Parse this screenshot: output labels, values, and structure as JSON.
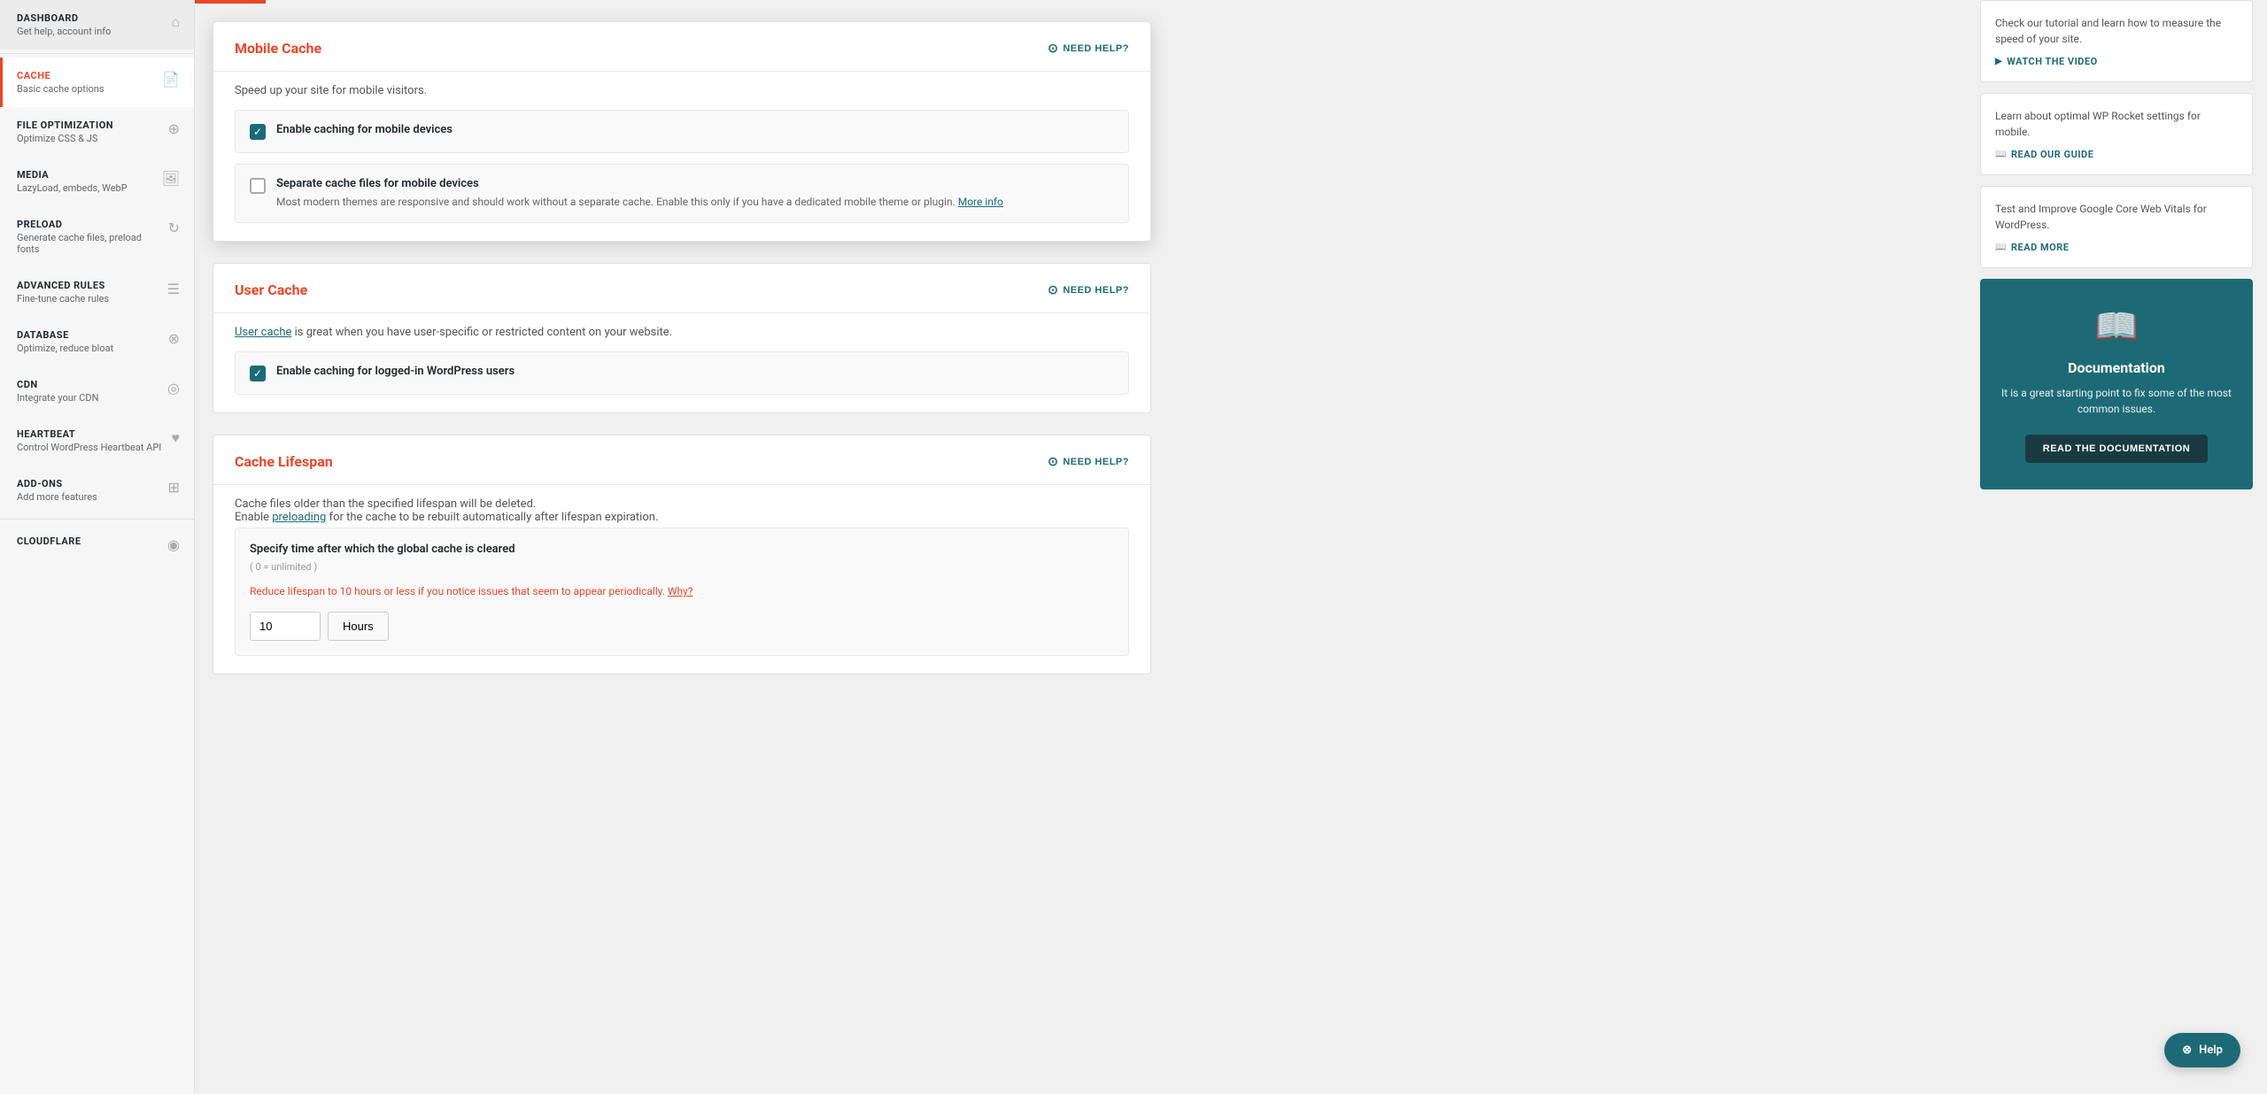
{
  "sidebar": {
    "items": [
      {
        "id": "dashboard",
        "title": "DASHBOARD",
        "subtitle": "Get help, account info",
        "icon": "⌂",
        "active": false
      },
      {
        "id": "cache",
        "title": "CACHE",
        "subtitle": "Basic cache options",
        "icon": "📄",
        "active": true
      },
      {
        "id": "file-optimization",
        "title": "FILE OPTIMIZATION",
        "subtitle": "Optimize CSS & JS",
        "icon": "⊕",
        "active": false
      },
      {
        "id": "media",
        "title": "MEDIA",
        "subtitle": "LazyLoad, embeds, WebP",
        "icon": "🖼",
        "active": false
      },
      {
        "id": "preload",
        "title": "PRELOAD",
        "subtitle": "Generate cache files, preload fonts",
        "icon": "↻",
        "active": false
      },
      {
        "id": "advanced-rules",
        "title": "ADVANCED RULES",
        "subtitle": "Fine-tune cache rules",
        "icon": "☰",
        "active": false
      },
      {
        "id": "database",
        "title": "DATABASE",
        "subtitle": "Optimize, reduce bloat",
        "icon": "⊗",
        "active": false
      },
      {
        "id": "cdn",
        "title": "CDN",
        "subtitle": "Integrate your CDN",
        "icon": "◎",
        "active": false
      },
      {
        "id": "heartbeat",
        "title": "HEARTBEAT",
        "subtitle": "Control WordPress Heartbeat API",
        "icon": "♥",
        "active": false
      },
      {
        "id": "add-ons",
        "title": "ADD-ONS",
        "subtitle": "Add more features",
        "icon": "⊞",
        "active": false
      },
      {
        "id": "cloudflare",
        "title": "Cloudflare",
        "subtitle": "",
        "icon": "◉",
        "active": false
      }
    ]
  },
  "mobile_cache": {
    "section_title": "Mobile Cache",
    "need_help": "NEED HELP?",
    "description": "Speed up your site for mobile visitors.",
    "options": [
      {
        "id": "enable-mobile-caching",
        "label": "Enable caching for mobile devices",
        "sublabel": "",
        "checked": true
      },
      {
        "id": "separate-cache-files",
        "label": "Separate cache files for mobile devices",
        "sublabel": "Most modern themes are responsive and should work without a separate cache. Enable this only if you have a dedicated mobile theme or plugin.",
        "more_info_text": "More info",
        "checked": false
      }
    ]
  },
  "user_cache": {
    "section_title": "User Cache",
    "need_help": "NEED HELP?",
    "description_part1": "User cache",
    "description_part2": " is great when you have user-specific or restricted content on your website.",
    "options": [
      {
        "id": "enable-logged-in-caching",
        "label": "Enable caching for logged-in WordPress users",
        "checked": true
      }
    ]
  },
  "cache_lifespan": {
    "section_title": "Cache Lifespan",
    "need_help": "NEED HELP?",
    "description_line1": "Cache files older than the specified lifespan will be deleted.",
    "description_line2_part1": "Enable ",
    "description_line2_link": "preloading",
    "description_line2_part2": " for the cache to be rebuilt automatically after lifespan expiration.",
    "spec_label": "Specify time after which the global cache is cleared",
    "spec_sublabel": "( 0 = unlimited )",
    "hint_text": "Reduce lifespan to 10 hours or less if you notice issues that seem to appear periodically.",
    "hint_link": "Why?",
    "value": "10",
    "unit": "Hours"
  },
  "right_sidebar": {
    "tips": [
      {
        "text": "Check our tutorial and learn how to measure the speed of your site.",
        "link_text": "WATCH THE VIDEO",
        "link_icon": "▶"
      },
      {
        "text": "Learn about optimal WP Rocket settings for mobile.",
        "link_text": "READ OUR GUIDE",
        "link_icon": "📖"
      },
      {
        "text": "Test and Improve Google Core Web Vitals for WordPress.",
        "link_text": "READ MORE",
        "link_icon": "📖"
      }
    ],
    "doc_card": {
      "icon": "📖",
      "title": "Documentation",
      "description": "It is a great starting point to fix some of the most common issues.",
      "button_label": "READ THE DOCUMENTATION"
    }
  },
  "help_fab": {
    "icon": "⊗",
    "label": "Help"
  }
}
